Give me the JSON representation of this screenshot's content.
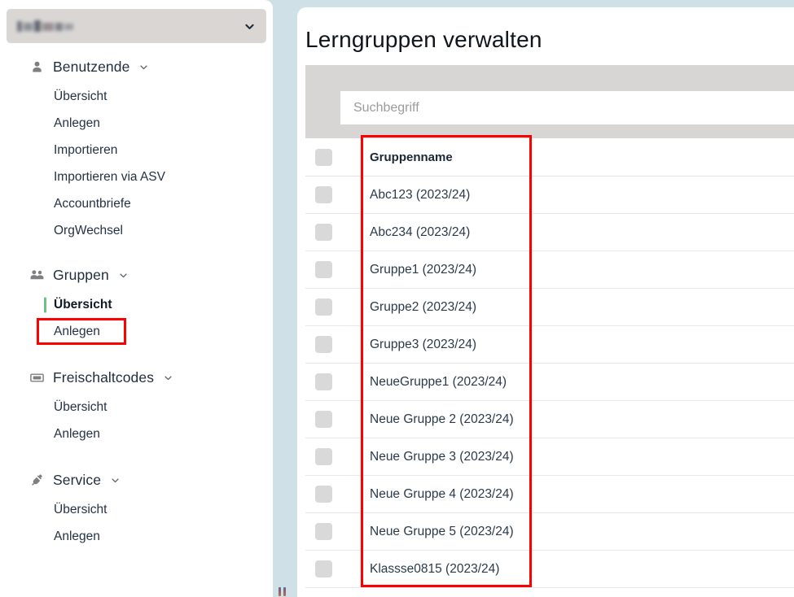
{
  "sidebar": {
    "org_selector": {
      "name": "",
      "redacted": true,
      "icon": "chevron-down-icon"
    },
    "groups": [
      {
        "label": "Benutzende",
        "icon": "user-icon",
        "caret": "chevron-down-icon",
        "items": [
          {
            "label": "Übersicht",
            "active": false
          },
          {
            "label": "Anlegen",
            "active": false
          },
          {
            "label": "Importieren",
            "active": false
          },
          {
            "label": "Importieren via ASV",
            "active": false
          },
          {
            "label": "Accountbriefe",
            "active": false
          },
          {
            "label": "OrgWechsel",
            "active": false
          }
        ]
      },
      {
        "label": "Gruppen",
        "icon": "users-group-icon",
        "caret": "chevron-down-icon",
        "items": [
          {
            "label": "Übersicht",
            "active": true
          },
          {
            "label": "Anlegen",
            "active": false
          }
        ]
      },
      {
        "label": "Freischaltcodes",
        "icon": "ticket-icon",
        "caret": "chevron-down-icon",
        "items": [
          {
            "label": "Übersicht",
            "active": false
          },
          {
            "label": "Anlegen",
            "active": false
          }
        ]
      },
      {
        "label": "Service",
        "icon": "plug-icon",
        "caret": "chevron-down-icon",
        "items": [
          {
            "label": "Übersicht",
            "active": false
          },
          {
            "label": "Anlegen",
            "active": false
          }
        ]
      }
    ],
    "resize_handle": "drag-handle-icon"
  },
  "main": {
    "title": "Lerngruppen verwalten",
    "search": {
      "placeholder": "Suchbegriff",
      "value": ""
    },
    "table": {
      "columns": [
        "",
        "Gruppenname"
      ],
      "header": {
        "select_all_checkbox": "",
        "name": "Gruppenname"
      },
      "rows": [
        {
          "checkbox": "",
          "name": "Abc123 (2023/24)"
        },
        {
          "checkbox": "",
          "name": "Abc234 (2023/24)"
        },
        {
          "checkbox": "",
          "name": "Gruppe1 (2023/24)"
        },
        {
          "checkbox": "",
          "name": "Gruppe2 (2023/24)"
        },
        {
          "checkbox": "",
          "name": "Gruppe3 (2023/24)"
        },
        {
          "checkbox": "",
          "name": "NeueGruppe1 (2023/24)"
        },
        {
          "checkbox": "",
          "name": "Neue Gruppe 2 (2023/24)"
        },
        {
          "checkbox": "",
          "name": "Neue Gruppe 3 (2023/24)"
        },
        {
          "checkbox": "",
          "name": "Neue Gruppe 4 (2023/24)"
        },
        {
          "checkbox": "",
          "name": "Neue Gruppe 5 (2023/24)"
        },
        {
          "checkbox": "",
          "name": "Klassse0815 (2023/24)"
        }
      ]
    }
  },
  "annotations": [
    {
      "name": "sidebar-uebersicht-highlight",
      "color": "#ff0000"
    },
    {
      "name": "gruppenname-column-highlight",
      "color": "#ff0000"
    }
  ],
  "colors": {
    "page_background": "#cfe0e6",
    "panel": "#ffffff",
    "band": "#d8d6d4",
    "org_selector": "#d9d6d4",
    "checkbox": "#d9d9d9",
    "active_accent": "#6cc08a",
    "annotation": "#ff0000",
    "text": "#2b3a4a"
  }
}
